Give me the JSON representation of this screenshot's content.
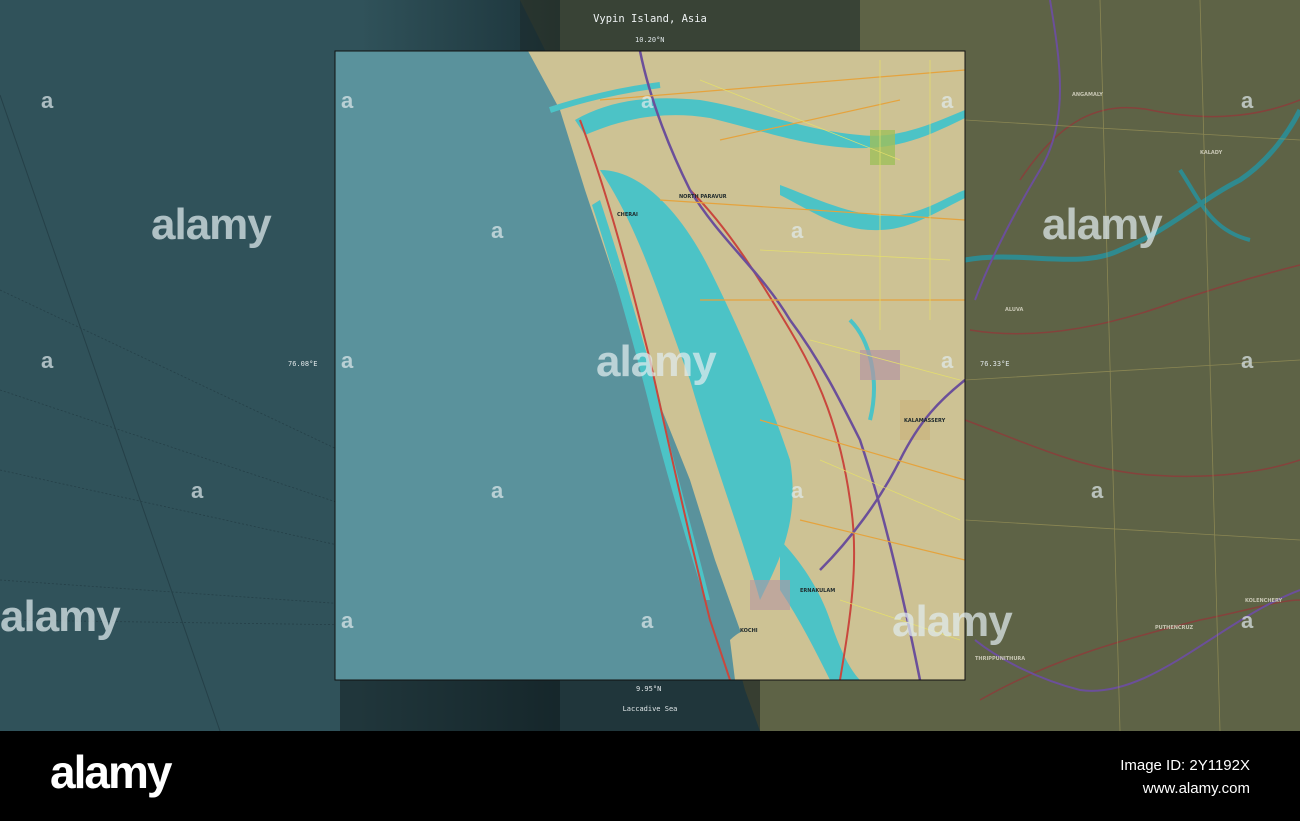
{
  "map": {
    "title": "Vypin Island, Asia",
    "lat_top": "10.20°N",
    "lat_bottom": "9.95°N",
    "lon_left": "76.08°E",
    "lon_right": "76.33°E",
    "sea_label": "Laccadive Sea",
    "places": {
      "north_paravur": "NORTH PARAVUR",
      "cherai": "CHERAI",
      "kalamassery": "KALAMASSERY",
      "ernakulam": "ERNAKULAM",
      "kochi": "KOCHI",
      "angamaly": "ANGAMALY",
      "kalady": "KALADY",
      "aluva": "ALUVA",
      "kolenchery": "KOLENCHERY",
      "puthencruz": "PUTHENCRUZ",
      "thrippunithura": "THRIPPUNITHURA"
    },
    "colors": {
      "sea": "#5a929c",
      "land": "#cdc294",
      "water": "#4cc3c6",
      "dim_sea": "#30525a",
      "dim_land": "#5e6346"
    }
  },
  "watermark": {
    "brand": "alamy",
    "mark": "a"
  },
  "footer": {
    "brand": "alamy",
    "image_id_label": "Image ID: 2Y1192X",
    "site": "www.alamy.com"
  }
}
